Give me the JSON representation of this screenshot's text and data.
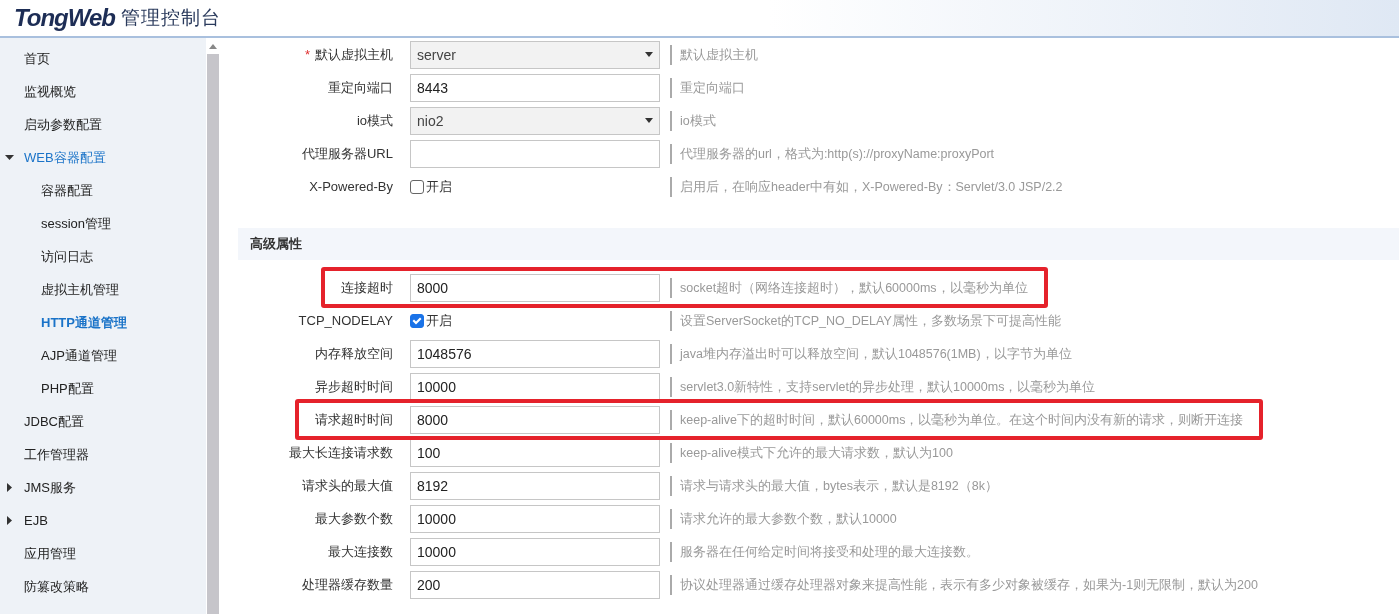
{
  "header": {
    "logo": "TongWeb",
    "title": "管理控制台"
  },
  "sidebar": {
    "items": [
      {
        "label": "首页",
        "selected": false
      },
      {
        "label": "监视概览",
        "selected": false
      },
      {
        "label": "启动参数配置",
        "selected": false
      },
      {
        "label": "WEB容器配置",
        "selected": false,
        "expanded": true,
        "children": [
          {
            "label": "容器配置",
            "selected": false
          },
          {
            "label": "session管理",
            "selected": false
          },
          {
            "label": "访问日志",
            "selected": false
          },
          {
            "label": "虚拟主机管理",
            "selected": false
          },
          {
            "label": "HTTP通道管理",
            "selected": true
          },
          {
            "label": "AJP通道管理",
            "selected": false
          },
          {
            "label": "PHP配置",
            "selected": false
          }
        ]
      },
      {
        "label": "JDBC配置",
        "selected": false
      },
      {
        "label": "工作管理器",
        "selected": false
      },
      {
        "label": "JMS服务",
        "selected": false,
        "expanded": false
      },
      {
        "label": "EJB",
        "selected": false,
        "expanded": false
      },
      {
        "label": "应用管理",
        "selected": false
      },
      {
        "label": "防篡改策略",
        "selected": false
      }
    ]
  },
  "sections": [
    {
      "fields": [
        {
          "kind": "select",
          "label": "默认虚拟主机",
          "required_mark": "*",
          "value": "server",
          "description": "默认虚拟主机",
          "highlighted": false
        },
        {
          "kind": "text",
          "label": "重定向端口",
          "value": "8443",
          "description": "重定向端口",
          "highlighted": false
        },
        {
          "kind": "select",
          "label": "io模式",
          "value": "nio2",
          "description": "io模式",
          "highlighted": false
        },
        {
          "kind": "text",
          "label": "代理服务器URL",
          "description": "代理服务器的url，格式为:http(s)://proxyName:proxyPort",
          "highlighted": false
        },
        {
          "kind": "checkbox",
          "label": "X-Powered-By",
          "option": "开启",
          "checked": false,
          "description": "启用后，在响应header中有如，X-Powered-By：Servlet/3.0 JSP/2.2",
          "highlighted": false
        }
      ]
    },
    {
      "title": "高级属性",
      "fields": [
        {
          "kind": "text",
          "label": "连接超时",
          "value": "8000",
          "description": "socket超时（网络连接超时），默认60000ms，以毫秒为单位",
          "highlighted": true
        },
        {
          "kind": "checkbox",
          "label": "TCP_NODELAY",
          "option": "开启",
          "checked": true,
          "description": "设置ServerSocket的TCP_NO_DELAY属性，多数场景下可提高性能",
          "highlighted": false
        },
        {
          "kind": "text",
          "label": "内存释放空间",
          "value": "1048576",
          "description": "java堆内存溢出时可以释放空间，默认1048576(1MB)，以字节为单位",
          "highlighted": false
        },
        {
          "kind": "text",
          "label": "异步超时时间",
          "value": "10000",
          "description": "servlet3.0新特性，支持servlet的异步处理，默认10000ms，以毫秒为单位",
          "highlighted": false
        },
        {
          "kind": "text",
          "label": "请求超时时间",
          "value": "8000",
          "description": "keep-alive下的超时时间，默认60000ms，以毫秒为单位。在这个时间内没有新的请求，则断开连接",
          "highlighted": true
        },
        {
          "kind": "text",
          "label": "最大长连接请求数",
          "value": "100",
          "description": "keep-alive模式下允许的最大请求数，默认为100",
          "highlighted": false
        },
        {
          "kind": "text",
          "label": "请求头的最大值",
          "value": "8192",
          "description": "请求与请求头的最大值，bytes表示，默认是8192（8k）",
          "highlighted": false
        },
        {
          "kind": "text",
          "label": "最大参数个数",
          "value": "10000",
          "description": "请求允许的最大参数个数，默认10000",
          "highlighted": false
        },
        {
          "kind": "text",
          "label": "最大连接数",
          "value": "10000",
          "description": "服务器在任何给定时间将接受和处理的最大连接数。",
          "highlighted": false
        },
        {
          "kind": "text",
          "label": "处理器缓存数量",
          "value": "200",
          "description": "协议处理器通过缓存处理器对象来提高性能，表示有多少对象被缓存，如果为-1则无限制，默认为200",
          "highlighted": false
        }
      ]
    }
  ]
}
